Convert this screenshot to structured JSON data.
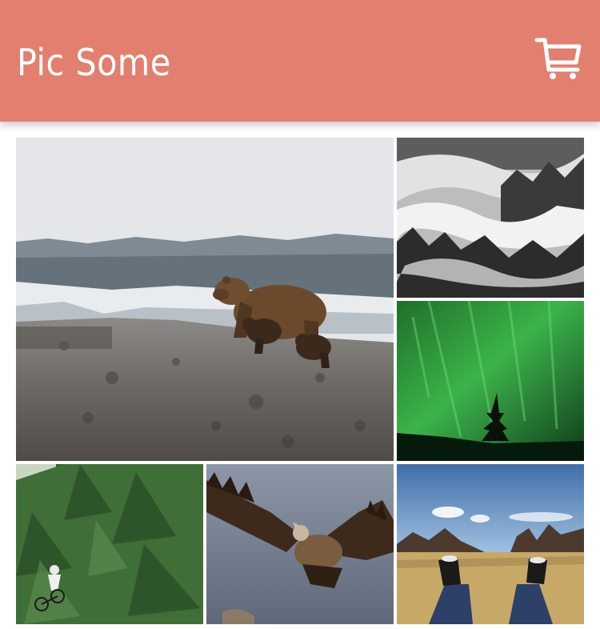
{
  "header": {
    "title": "Pic Some",
    "cart_icon": "shopping-cart-icon",
    "background": "#e27f6f"
  },
  "gallery": {
    "photos": [
      {
        "subject": "bear-with-cubs",
        "layout": "big"
      },
      {
        "subject": "misty-forest-bw",
        "layout": "normal"
      },
      {
        "subject": "green-aurora",
        "layout": "normal"
      },
      {
        "subject": "mountain-biker-forest",
        "layout": "normal"
      },
      {
        "subject": "vulture-flying",
        "layout": "normal"
      },
      {
        "subject": "feet-on-field",
        "layout": "normal"
      }
    ]
  }
}
